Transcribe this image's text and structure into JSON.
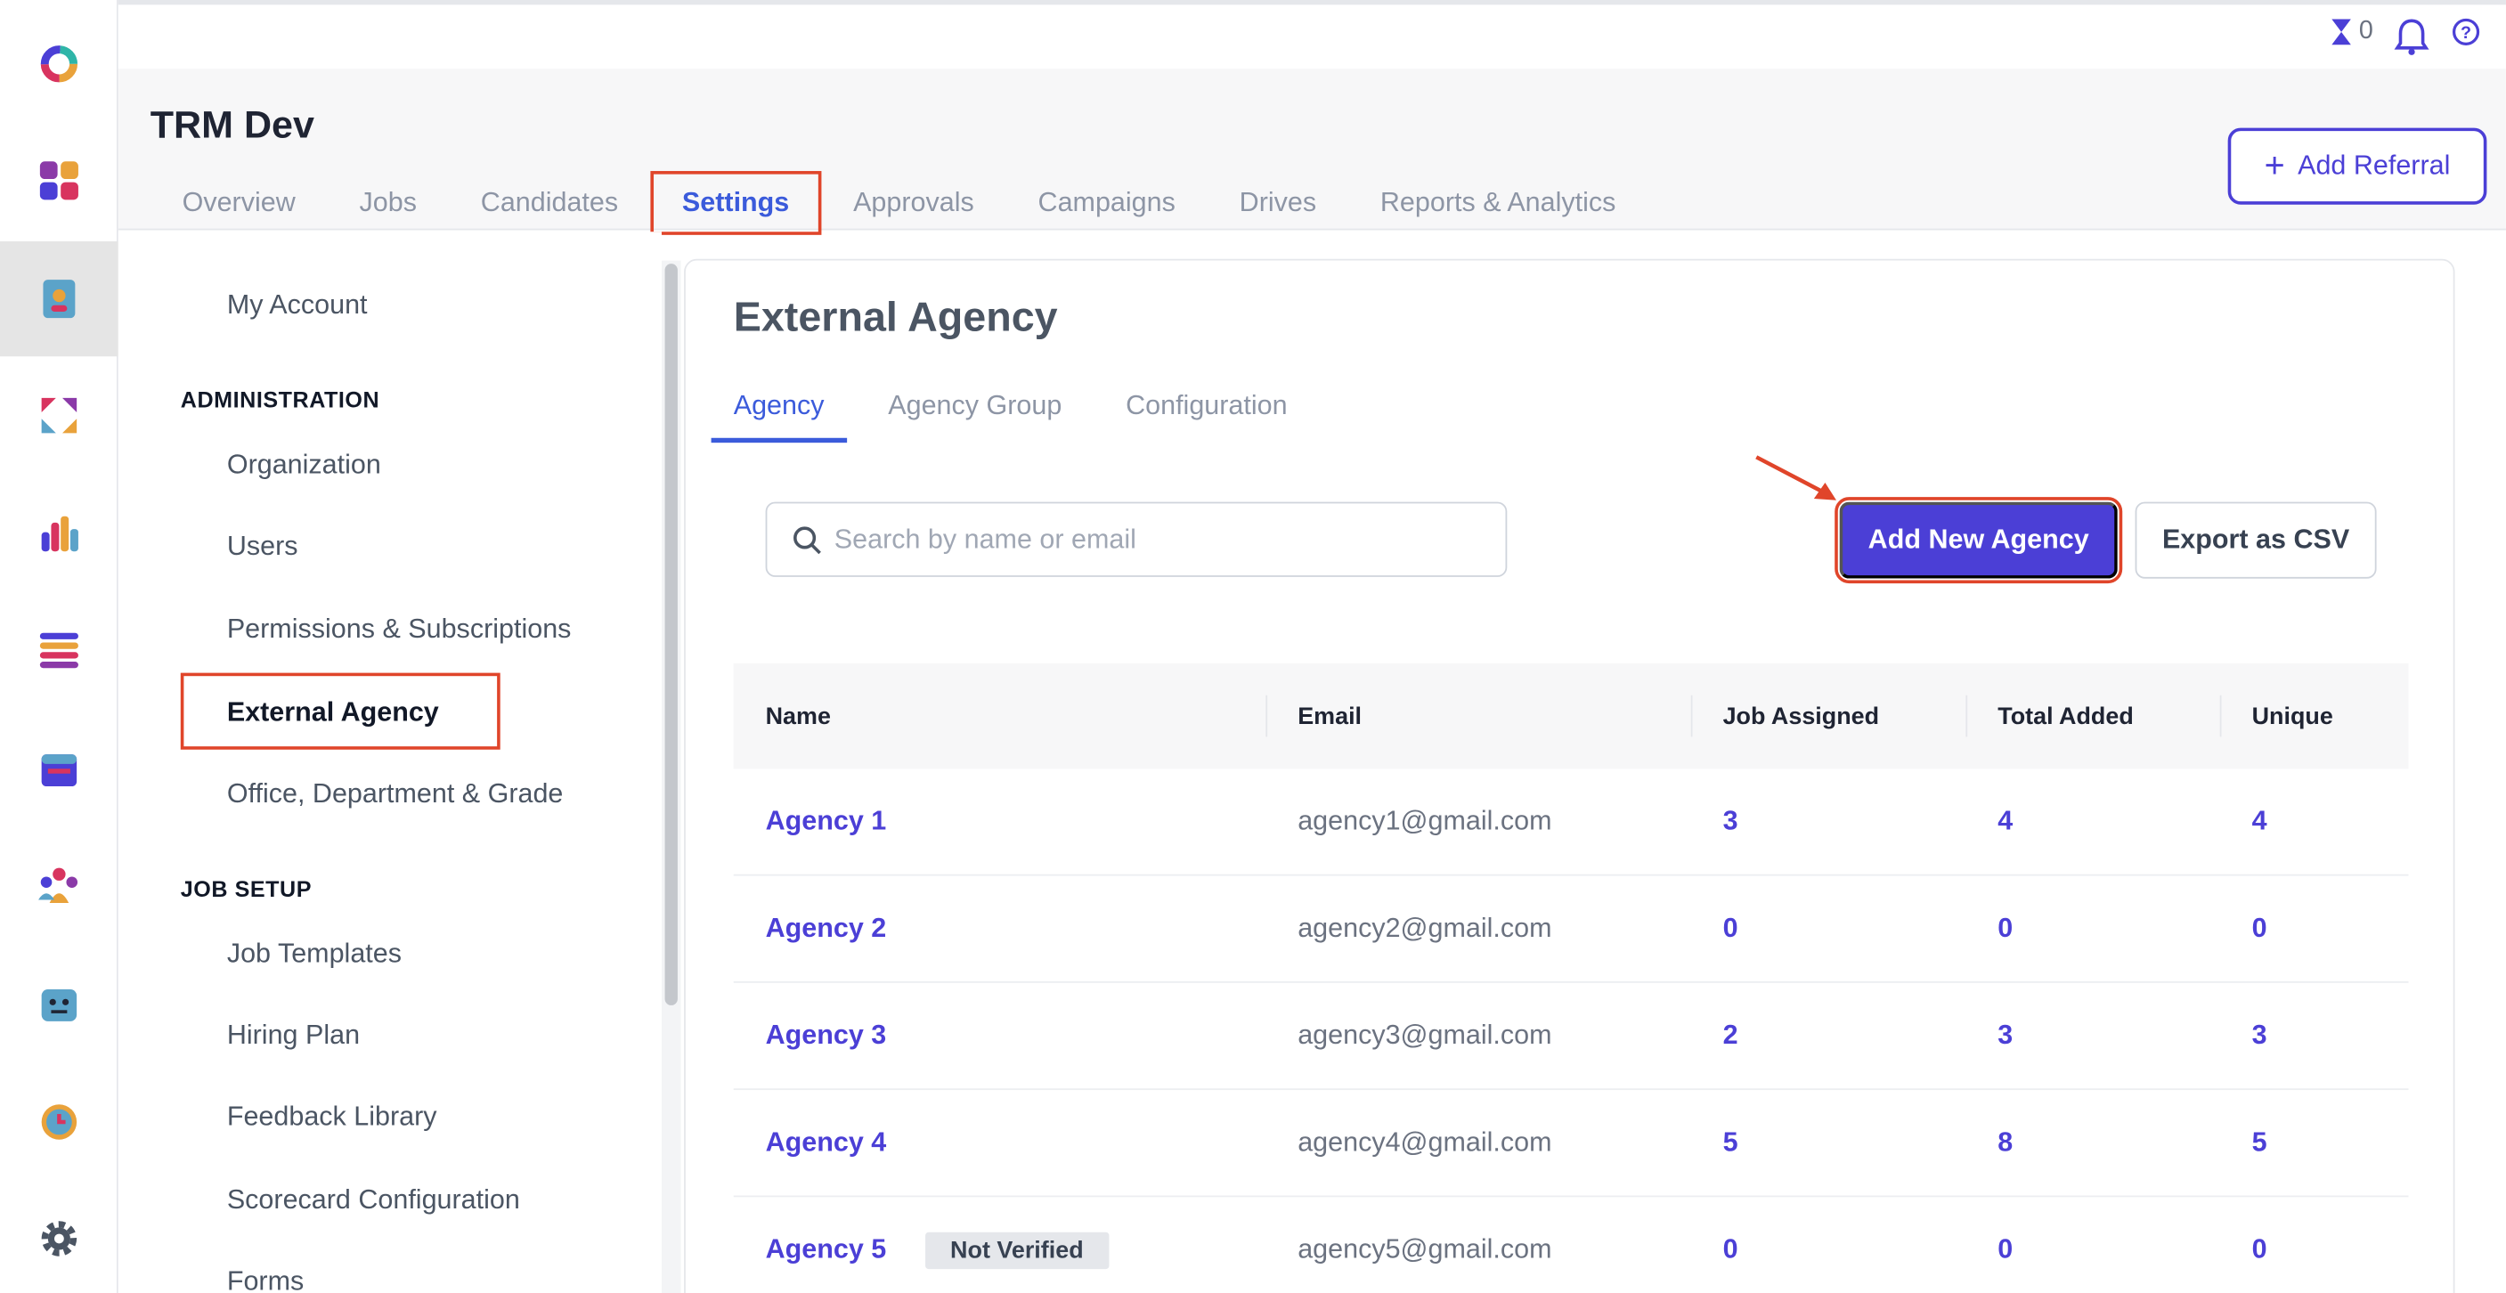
{
  "rail": {
    "icons": [
      "app-logo-icon",
      "dashboard-icon",
      "referrals-icon",
      "exchange-icon",
      "bar-chart-icon",
      "list-icon",
      "calendar-icon",
      "people-icon",
      "bot-icon",
      "alarm-clock-icon",
      "settings-gear-icon"
    ]
  },
  "header": {
    "timer_count": "0",
    "app_title": "TRM Dev",
    "tabs": [
      {
        "label": "Overview"
      },
      {
        "label": "Jobs"
      },
      {
        "label": "Candidates"
      },
      {
        "label": "Settings"
      },
      {
        "label": "Approvals"
      },
      {
        "label": "Campaigns"
      },
      {
        "label": "Drives"
      },
      {
        "label": "Reports & Analytics"
      }
    ],
    "active_tab": "Settings",
    "add_referral_label": "Add Referral"
  },
  "sidebar": {
    "my_account": "My Account",
    "administration_heading": "ADMINISTRATION",
    "administration_items": [
      {
        "label": "Organization"
      },
      {
        "label": "Users"
      },
      {
        "label": "Permissions & Subscriptions"
      },
      {
        "label": "External Agency"
      },
      {
        "label": "Office, Department & Grade"
      }
    ],
    "job_setup_heading": "JOB SETUP",
    "job_setup_items": [
      {
        "label": "Job Templates"
      },
      {
        "label": "Hiring Plan"
      },
      {
        "label": "Feedback Library"
      },
      {
        "label": "Scorecard Configuration"
      },
      {
        "label": "Forms"
      }
    ],
    "active_item": "External Agency"
  },
  "main": {
    "title": "External Agency",
    "subtabs": [
      {
        "label": "Agency"
      },
      {
        "label": "Agency Group"
      },
      {
        "label": "Configuration"
      }
    ],
    "active_subtab": "Agency",
    "search_placeholder": "Search by name or email",
    "add_button": "Add New Agency",
    "export_button": "Export as CSV",
    "table": {
      "columns": [
        "Name",
        "Email",
        "Job Assigned",
        "Total Added",
        "Unique"
      ],
      "rows": [
        {
          "name": "Agency 1",
          "badge": "",
          "email": "agency1@gmail.com",
          "job_assigned": "3",
          "total_added": "4",
          "unique": "4"
        },
        {
          "name": "Agency 2",
          "badge": "",
          "email": "agency2@gmail.com",
          "job_assigned": "0",
          "total_added": "0",
          "unique": "0"
        },
        {
          "name": "Agency 3",
          "badge": "",
          "email": "agency3@gmail.com",
          "job_assigned": "2",
          "total_added": "3",
          "unique": "3"
        },
        {
          "name": "Agency 4",
          "badge": "",
          "email": "agency4@gmail.com",
          "job_assigned": "5",
          "total_added": "8",
          "unique": "5"
        },
        {
          "name": "Agency 5",
          "badge": "Not Verified",
          "email": "agency5@gmail.com",
          "job_assigned": "0",
          "total_added": "0",
          "unique": "0"
        }
      ]
    }
  },
  "colors": {
    "accent": "#4b3fd6",
    "tab_active": "#3b5bdb",
    "highlight_annotation": "#e0452a"
  }
}
